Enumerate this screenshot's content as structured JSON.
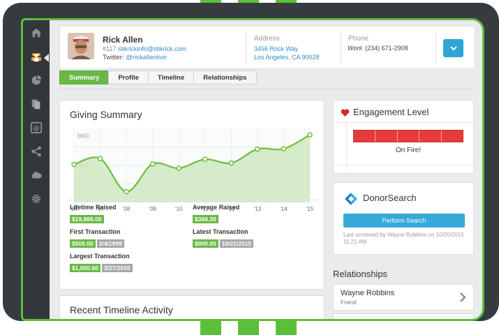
{
  "contact": {
    "name": "Rick Allen",
    "id": "#117",
    "email": "stikrickinfo@stikrick.com",
    "twitter_label": "Twitter:",
    "twitter": "@rickallenlive"
  },
  "address": {
    "label": "Address",
    "line1": "3456 Rock Way",
    "line2": "Los Angeles, CA 90028"
  },
  "phone": {
    "label": "Phone",
    "type": "Work",
    "number": "(234) 671-2908"
  },
  "tabs": [
    {
      "label": "Summary",
      "active": true
    },
    {
      "label": "Profile",
      "active": false
    },
    {
      "label": "Timeline",
      "active": false
    },
    {
      "label": "Relationships",
      "active": false
    }
  ],
  "giving": {
    "title": "Giving Summary",
    "lifetime_label": "Lifetime Raised",
    "lifetime_value": "$19,888.00",
    "average_label": "Average Raised",
    "average_value": "$368.30",
    "first_label": "First Transaction",
    "first_value": "$500.00",
    "first_date": "2/4/1999",
    "latest_label": "Latest Transaction",
    "latest_value": "$900.00",
    "latest_date": "10/21/2015",
    "largest_label": "Largest Transaction",
    "largest_value": "$1,000.00",
    "largest_date": "3/27/2010"
  },
  "recent": {
    "title": "Recent Timeline Activity"
  },
  "engagement": {
    "title": "Engagement Level",
    "status": "On Fire!",
    "level": 1.0
  },
  "donorsearch": {
    "title": "DonorSearch",
    "button": "Perform Search",
    "screened": "Last screened by Wayne Robbins on 10/20/2015 11:21 AM"
  },
  "relationships": {
    "title": "Relationships",
    "items": [
      {
        "name": "Wayne Robbins",
        "role": "Friend"
      }
    ]
  },
  "colors": {
    "brand_green": "#5cbf3c",
    "accent_blue": "#2da6d6",
    "engagement_red": "#e53b3b"
  },
  "chart_data": {
    "type": "area",
    "x": [
      "'06",
      "'07",
      "'08",
      "'09",
      "'10",
      "'11",
      "'12",
      "'13",
      "'14",
      "'15"
    ],
    "values": [
      2050,
      2370,
      580,
      2080,
      1850,
      2330,
      2130,
      2880,
      2900,
      3650
    ],
    "ytick_labels": [
      "3600",
      "2000"
    ],
    "ylim": [
      0,
      4000
    ]
  }
}
